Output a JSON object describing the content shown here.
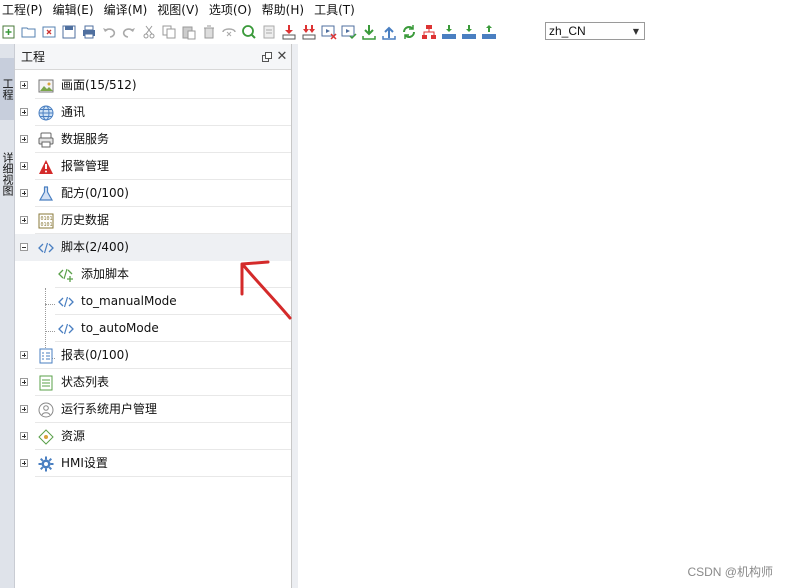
{
  "menu": {
    "items": [
      "工程(P)",
      "编辑(E)",
      "编译(M)",
      "视图(V)",
      "选项(O)",
      "帮助(H)",
      "工具(T)"
    ]
  },
  "toolbar": {
    "icons": [
      "new-icon",
      "open-icon",
      "close-project-icon",
      "save-icon",
      "print-icon",
      "undo-icon",
      "redo-icon",
      "cut-icon",
      "copy-icon",
      "paste-icon",
      "delete-icon",
      "compile-icon",
      "search-icon",
      "file-icon",
      "download-red-icon",
      "download-red2-icon",
      "sim-offline-icon",
      "sim-online-icon",
      "download-green-icon",
      "upload-icon",
      "refresh-icon",
      "network-icon",
      "usb-download-icon",
      "usb-download2-icon",
      "usb-upload-icon"
    ],
    "language": "zh_CN"
  },
  "left_strip": {
    "tabs": [
      "工程",
      "详细视图"
    ]
  },
  "panel": {
    "title": "工程"
  },
  "tree": {
    "items": [
      {
        "label": "画面(15/512)",
        "icon": "picture-icon",
        "expanded": false
      },
      {
        "label": "通讯",
        "icon": "globe-icon",
        "expanded": false
      },
      {
        "label": "数据服务",
        "icon": "database-icon",
        "expanded": false
      },
      {
        "label": "报警管理",
        "icon": "warning-icon",
        "expanded": false
      },
      {
        "label": "配方(0/100)",
        "icon": "flask-icon",
        "expanded": false
      },
      {
        "label": "历史数据",
        "icon": "binary-icon",
        "expanded": false
      },
      {
        "label": "脚本(2/400)",
        "icon": "code-icon",
        "expanded": true,
        "children": [
          {
            "label": "添加脚本",
            "icon": "add-script-icon"
          },
          {
            "label": "to_manualMode",
            "icon": "code-icon"
          },
          {
            "label": "to_autoMode",
            "icon": "code-icon"
          }
        ]
      },
      {
        "label": "报表(0/100)",
        "icon": "report-icon",
        "expanded": false
      },
      {
        "label": "状态列表",
        "icon": "list-icon",
        "expanded": false
      },
      {
        "label": "运行系统用户管理",
        "icon": "user-icon",
        "expanded": false
      },
      {
        "label": "资源",
        "icon": "resource-icon",
        "expanded": false
      },
      {
        "label": "HMI设置",
        "icon": "gear-icon",
        "expanded": false
      }
    ]
  },
  "watermark": "CSDN @机构师",
  "colors": {
    "accent_red": "#d42a2a",
    "code_blue": "#4a7fc1",
    "strip_bg": "#dfe3ea"
  }
}
